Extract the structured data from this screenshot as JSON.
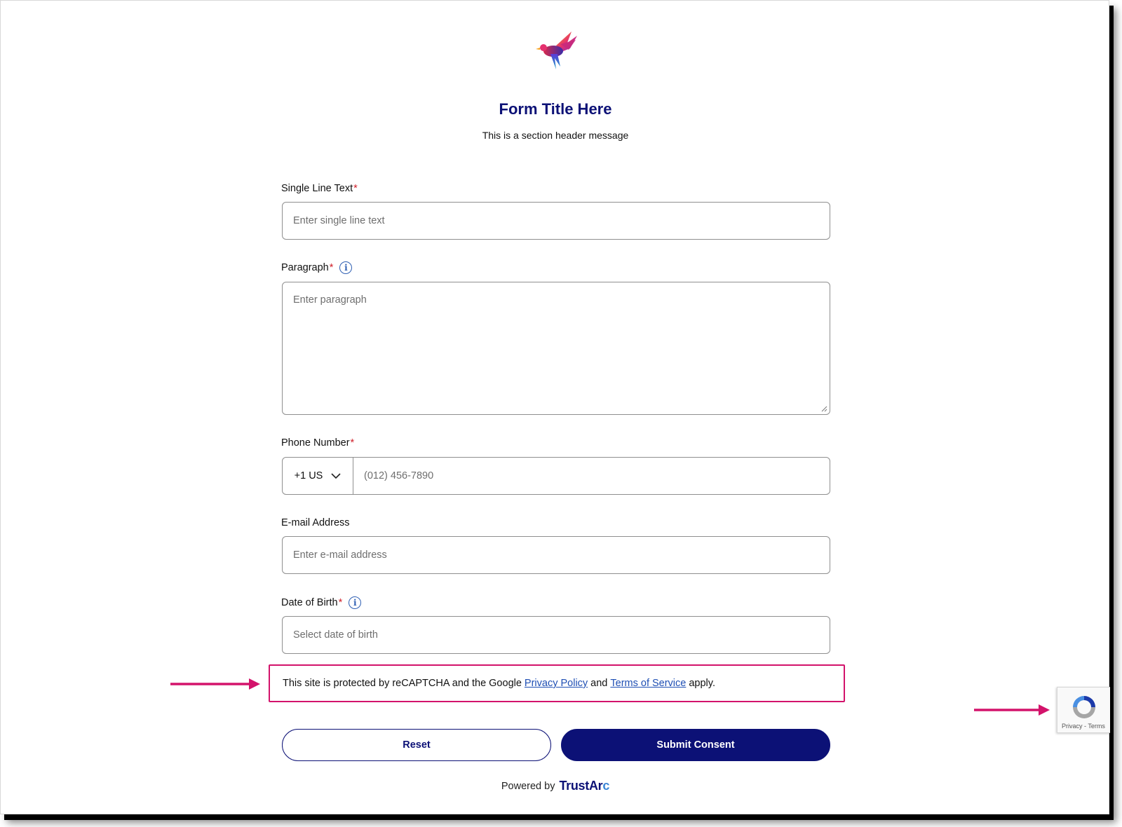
{
  "form": {
    "title": "Form Title Here",
    "subtitle": "This is a section header message"
  },
  "fields": {
    "single_line": {
      "label": "Single Line Text",
      "required": "*",
      "placeholder": "Enter single line text"
    },
    "paragraph": {
      "label": "Paragraph",
      "required": "*",
      "placeholder": "Enter paragraph"
    },
    "phone": {
      "label": "Phone Number",
      "required": "*",
      "country_code": "+1 US",
      "placeholder": "(012) 456-7890"
    },
    "email": {
      "label": "E-mail Address",
      "placeholder": "Enter e-mail address"
    },
    "dob": {
      "label": "Date of Birth",
      "required": "*",
      "placeholder": "Select date of birth"
    }
  },
  "recaptcha": {
    "text_before": "This site is protected by reCAPTCHA and the Google",
    "privacy_link": "Privacy Policy",
    "text_and": "and",
    "terms_link": "Terms of Service",
    "text_after": "apply.",
    "badge_privacy": "Privacy",
    "badge_sep": " - ",
    "badge_terms": "Terms"
  },
  "buttons": {
    "reset": "Reset",
    "submit": "Submit Consent"
  },
  "footer": {
    "powered_by": "Powered by",
    "brand_main": "TrustA",
    "brand_r": "r",
    "brand_arc": "c"
  },
  "icons": {
    "logo": "bird-logo-icon",
    "info": "info-icon",
    "dropdown": "chevron-down-icon",
    "arrow": "arrow-right-icon",
    "recaptcha": "recaptcha-icon"
  },
  "colors": {
    "brand_navy": "#0c1176",
    "link_blue": "#1f4fb4",
    "highlight_pink": "#d3136b",
    "required_red": "#d0202a"
  }
}
